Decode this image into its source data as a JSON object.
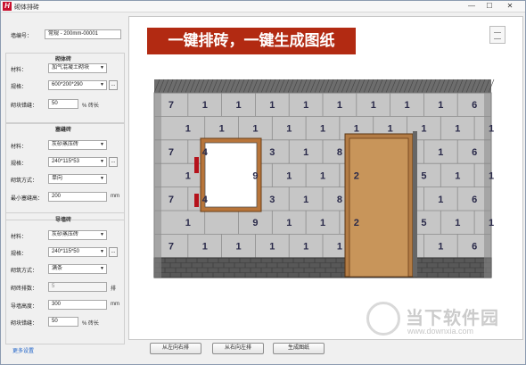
{
  "window": {
    "title": "砌体排砖",
    "app_icon_letter": "H",
    "minimize": "—",
    "maximize": "☐",
    "close": "✕"
  },
  "form": {
    "wall_id": {
      "label": "墙编号：",
      "value": "常规 - 200mm-00001"
    },
    "masonry": {
      "title": "砌体砖",
      "material": {
        "label": "材料：",
        "value": "加气混凝土砌块"
      },
      "spec": {
        "label": "规格：",
        "value": "600*200*290",
        "button": "..."
      },
      "offset": {
        "label": "砌块错缝：",
        "value": "50",
        "unit": "% 砖长"
      }
    },
    "top_brick": {
      "title": "塞缝砖",
      "material": {
        "label": "材料：",
        "value": "灰砂蒸压砖"
      },
      "spec": {
        "label": "规格：",
        "value": "240*115*53",
        "button": "..."
      },
      "method": {
        "label": "砌筑方式：",
        "value": "单向"
      },
      "min_height": {
        "label": "最小塞缝高：",
        "value": "200",
        "unit": "mm"
      }
    },
    "guide_brick": {
      "title": "导墙砖",
      "material": {
        "label": "材料：",
        "value": "灰砂蒸压砖"
      },
      "spec": {
        "label": "规格：",
        "value": "240*115*50",
        "button": "..."
      },
      "method": {
        "label": "砌筑方式：",
        "value": "满条"
      },
      "rows": {
        "label": "砌砖排数：",
        "value": "5",
        "unit": "排"
      },
      "height": {
        "label": "导墙高度：",
        "value": "300",
        "unit": "mm"
      },
      "offset": {
        "label": "砌块错缝：",
        "value": "50",
        "unit": "% 砖长"
      }
    },
    "more_settings": "更多设置"
  },
  "canvas": {
    "banner": "一键排砖，一键生成图纸",
    "print_icon": "print-icon",
    "row_numbers": [
      [
        "7",
        "1",
        "1",
        "1",
        "1",
        "1",
        "1",
        "1",
        "1",
        "6"
      ],
      [
        "1",
        "1",
        "1",
        "1",
        "1",
        "1",
        "1",
        "1",
        "1",
        "1"
      ],
      [
        "7",
        "4",
        "",
        "3",
        "1",
        "8",
        "",
        "",
        "1",
        "6"
      ],
      [
        "1",
        "",
        "9",
        "1",
        "1",
        "2",
        "",
        "5",
        "1",
        "1"
      ],
      [
        "7",
        "4",
        "",
        "3",
        "1",
        "8",
        "",
        "",
        "1",
        "6"
      ],
      [
        "1",
        "",
        "9",
        "1",
        "1",
        "2",
        "",
        "5",
        "1",
        "1"
      ],
      [
        "7",
        "1",
        "1",
        "1",
        "1",
        "1",
        "",
        "",
        "1",
        "6"
      ]
    ]
  },
  "buttons": {
    "left_to_right": "从左向右排",
    "right_to_left": "从右向左排",
    "generate": "生成图纸"
  },
  "watermark": {
    "name": "当下软件园",
    "url": "www.downxia.com"
  },
  "colors": {
    "banner_bg": "#b22a12",
    "brick": "#c4c4c4",
    "mortar": "#7a7a7a",
    "bottom_brick": "#555555",
    "door": "#c8955a",
    "window_frame": "#b8753a",
    "accent_link": "#1e62c8"
  }
}
